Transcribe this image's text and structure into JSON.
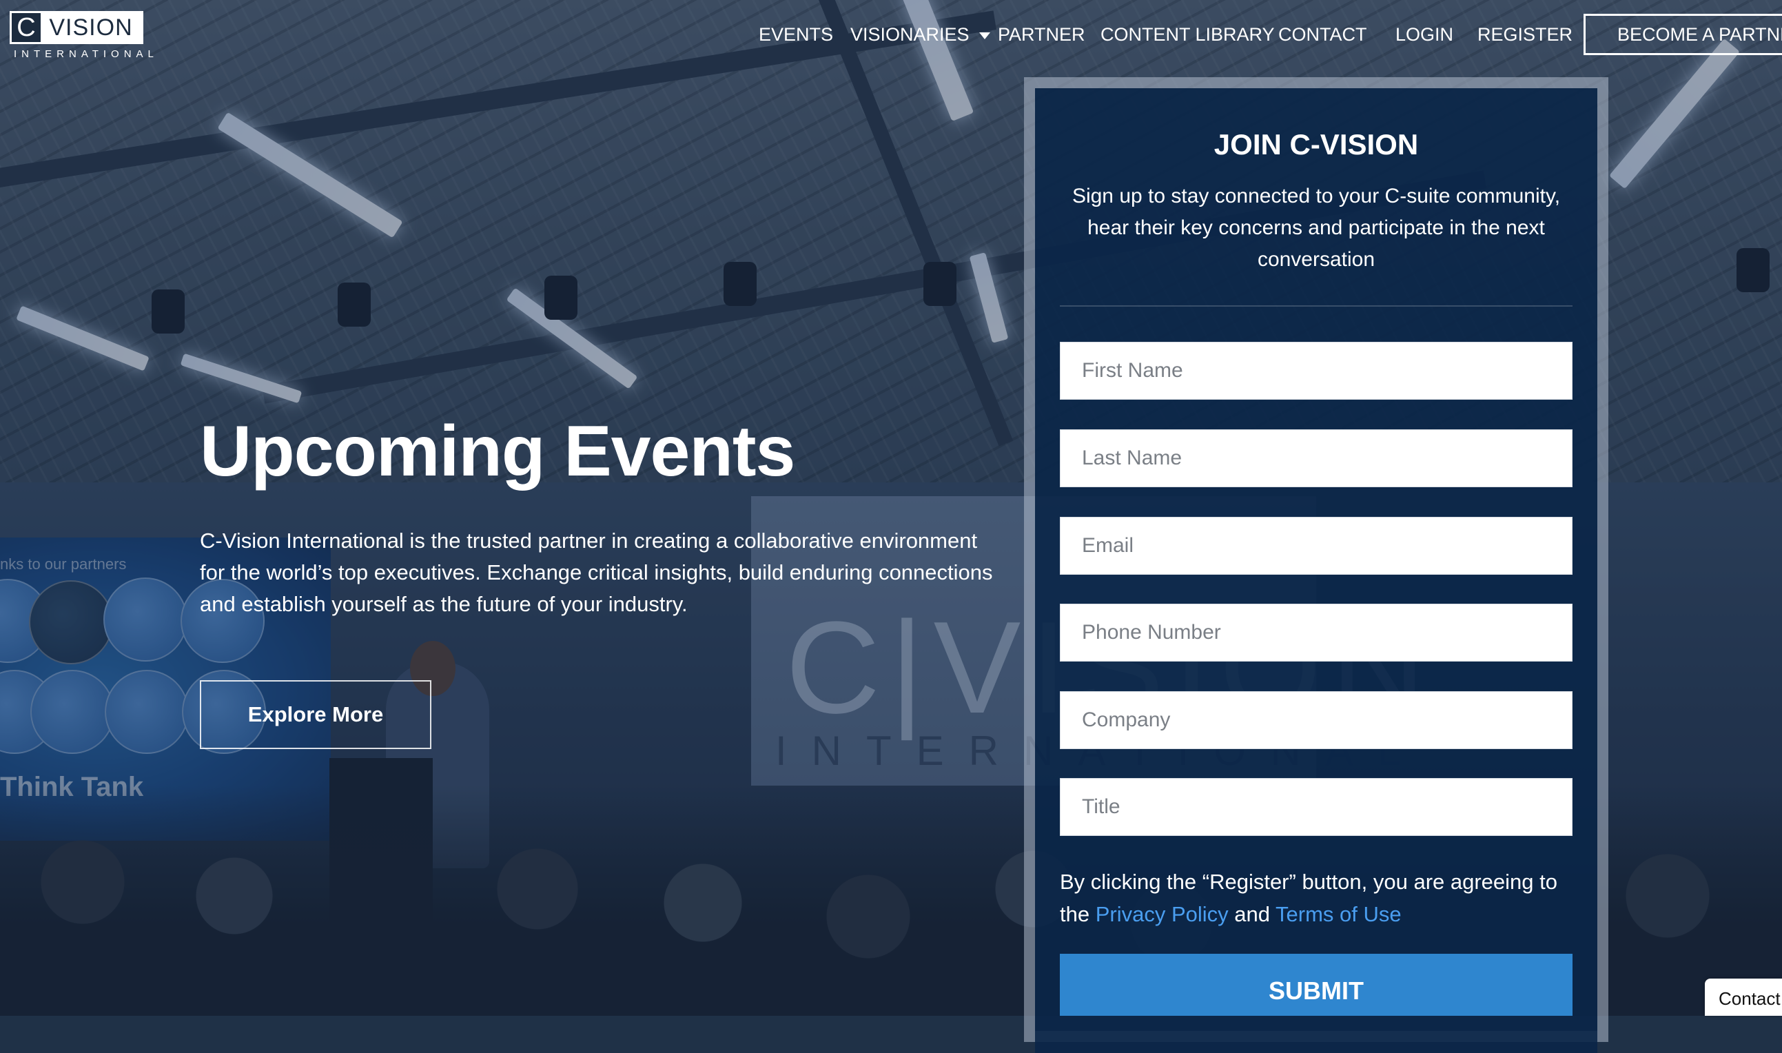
{
  "logo": {
    "letter": "C",
    "word": "VISION",
    "sub": "INTERNATIONAL"
  },
  "nav": {
    "items": [
      "EVENTS",
      "VISIONARIES",
      "PARTNER",
      "CONTENT LIBRARY",
      "CONTACT",
      "LOGIN",
      "REGISTER"
    ],
    "cta": "BECOME A PARTNER"
  },
  "hero": {
    "title": "Upcoming Events",
    "text": "C-Vision International is the trusted partner in creating a collaborative environment for the world’s top executives. Exchange critical insights, build enduring connections and establish yourself as the future of your industry.",
    "button": "Explore More"
  },
  "background": {
    "partners_caption": "nks to our partners",
    "think_tank": "Think Tank",
    "screen_text": "C|VISION",
    "screen_sub": "INTERNATIONAL"
  },
  "join": {
    "title": "JOIN C-VISION",
    "subtitle": "Sign up to stay connected to your C-suite community, hear their key concerns and participate in the next conversation",
    "fields": {
      "first_name": "First Name",
      "last_name": "Last Name",
      "email": "Email",
      "phone": "Phone Number",
      "company": "Company",
      "title": "Title"
    },
    "consent_prefix": "By clicking the “Register” button, you are agreeing to the ",
    "privacy": "Privacy Policy",
    "consent_and": " and ",
    "terms": "Terms of Use",
    "submit": "SUBMIT"
  },
  "contact_tab": "Contact",
  "colors": {
    "link": "#4a9ef0",
    "submit": "#2f86cf",
    "panel": "#0a2648"
  }
}
